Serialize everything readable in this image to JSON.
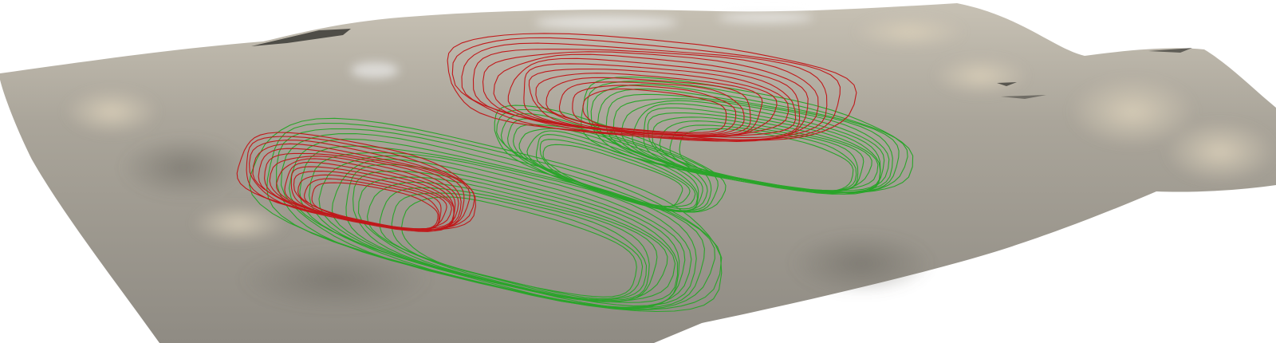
{
  "scene": {
    "background_color": "#ffffff",
    "terrain_color": "#a7a298",
    "terrain_highlight_color": "#c9c0ad",
    "terrain_shadow_color": "#7a776f",
    "pit_design_color": "#2aa52a",
    "current_surface_color": "#c0191b"
  }
}
